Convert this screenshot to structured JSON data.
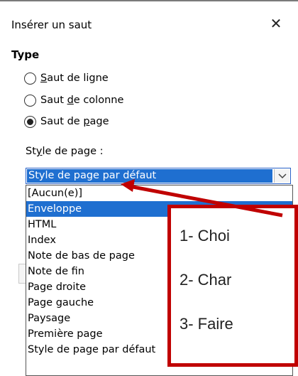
{
  "dialog": {
    "title": "Insérer un saut",
    "close_glyph": "✕"
  },
  "type_section": {
    "title": "Type",
    "options": [
      {
        "pre": "",
        "ul": "S",
        "post": "aut de ligne",
        "selected": false
      },
      {
        "pre": "Saut ",
        "ul": "d",
        "post": "e colonne",
        "selected": false
      },
      {
        "pre": "Saut de ",
        "ul": "p",
        "post": "age",
        "selected": true
      }
    ]
  },
  "style": {
    "label_pre": "St",
    "label_ul": "y",
    "label_post": "le de page :",
    "current_value": "Style de page par défaut",
    "dropdown_icon": "chevron-down-icon"
  },
  "dropdown_items": [
    "[Aucun(e)]",
    "Enveloppe",
    "HTML",
    "Index",
    "Note de bas de page",
    "Note de fin",
    "Page droite",
    "Page gauche",
    "Paysage",
    "Première page",
    "Style de page par défaut"
  ],
  "highlighted_item": "Enveloppe",
  "annotation": {
    "color": "#c00000",
    "steps": [
      "1- Choi",
      "2- Char",
      "3- Faire"
    ]
  },
  "colors": {
    "selection": "#1f6fd0",
    "annotation_red": "#c00000"
  }
}
